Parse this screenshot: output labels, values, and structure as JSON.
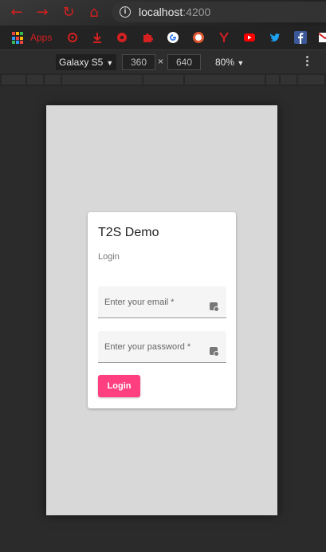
{
  "browser": {
    "url_host": "localhost",
    "url_port": ":4200",
    "nav_icons": [
      "back-icon",
      "forward-icon",
      "reload-icon",
      "home-icon"
    ]
  },
  "bookmarks": {
    "apps_label": "Apps",
    "icons": [
      "gear-icon",
      "download-icon",
      "settings-icon",
      "puzzle-icon",
      "google-icon",
      "duckduckgo-icon",
      "y-icon",
      "youtube-icon",
      "twitter-icon",
      "facebook-icon",
      "gmail-icon"
    ]
  },
  "device_toolbar": {
    "device": "Galaxy S5",
    "width": "360",
    "separator": "×",
    "height": "640",
    "zoom": "80%"
  },
  "app": {
    "title": "T2S Demo",
    "subtitle": "Login",
    "email_placeholder": "Enter your email *",
    "password_placeholder": "Enter your password *",
    "login_button": "Login",
    "accent_color": "#ff3f7f"
  }
}
